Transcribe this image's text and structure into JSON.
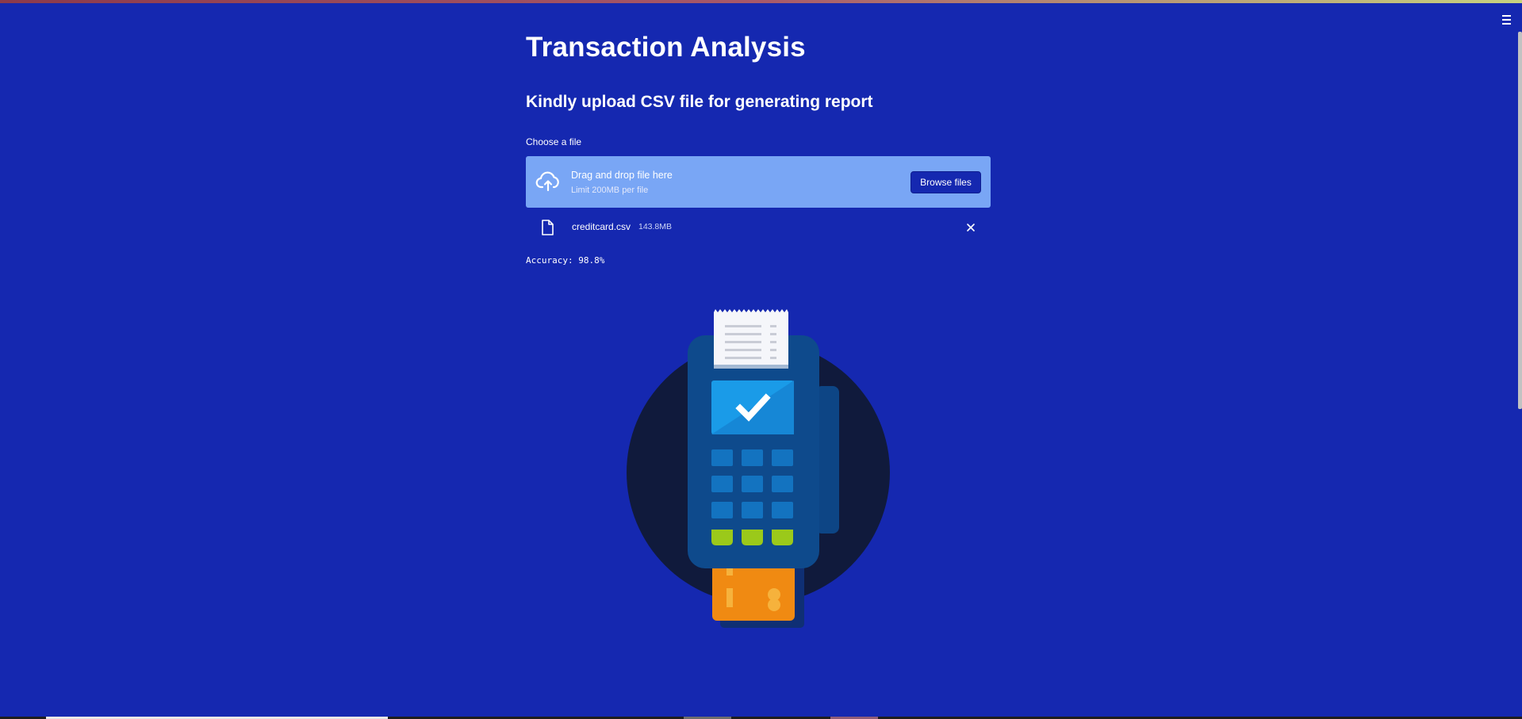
{
  "app": {
    "title": "Transaction Analysis",
    "subtitle": "Kindly upload CSV file for generating report"
  },
  "uploader": {
    "label": "Choose a file",
    "drop_title": "Drag and drop file here",
    "drop_limit": "Limit 200MB per file",
    "browse_label": "Browse files",
    "icon": "cloud-upload-icon"
  },
  "uploaded_file": {
    "name": "creditcard.csv",
    "size": "143.8MB",
    "icon": "file-icon",
    "remove_icon": "close-icon"
  },
  "result": {
    "accuracy_text": "Accuracy: 98.8%"
  },
  "colors": {
    "background": "#1528b0",
    "dropzone": "#79a6f5",
    "button": "#1528b0",
    "terminal_body": "#0e4a8c",
    "terminal_screen": "#1a9be8",
    "card": "#f08a12",
    "keypad_green": "#9bc91a",
    "circle": "#101a3c"
  }
}
